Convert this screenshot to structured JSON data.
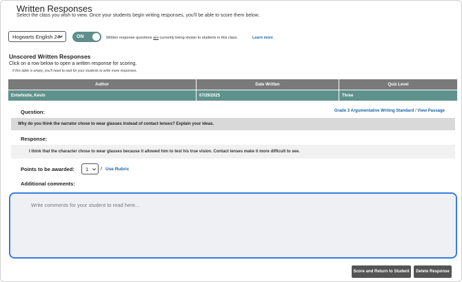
{
  "header": {
    "title": "Written Responses",
    "subtitle": "Select the class you wish to view. Once your students begin writing responses, you'll be able to score them below."
  },
  "class_selector": {
    "selected": "Hogwarts English 24"
  },
  "toggle": {
    "label": "ON",
    "state": "on",
    "color": "#5e8e8a"
  },
  "toggle_note": {
    "before": "Written response questions ",
    "emphasis": "are",
    "after": " currently being shown to students in this class.",
    "learn_more": "Learn more"
  },
  "unscored": {
    "title": "Unscored Written Responses",
    "instruction": "Click on a row below to open a written response for scoring.",
    "note": "If this table is empty, you'll need to wait for your students to write more responses."
  },
  "table": {
    "columns": [
      "Author",
      "Date Written",
      "Quiz Level"
    ],
    "rows": [
      {
        "author": "Entwhistle, Kevin",
        "date": "07/29/2025",
        "level": "Three"
      }
    ],
    "header_color": "#7a7a7a",
    "row_color": "#5f928d"
  },
  "question": {
    "label": "Question:",
    "standard_link": "Grade 3 Argumentative Writing Standard",
    "separator": "/",
    "passage_link": "View Passage",
    "text": "Why do you think the narrator chose to wear glasses instead of contact lenses? Explain your ideas."
  },
  "response": {
    "label": "Response:",
    "text": "I think that the character chose to wear glasses because it allowed him to test his true vision. Contact lenses make it more difficult to see."
  },
  "points": {
    "label": "Points to be awarded:",
    "value": "1",
    "slash": "/",
    "rubric_link": "Use Rubric"
  },
  "comments": {
    "label": "Additional comments:",
    "placeholder": "Write comments for your student to read here...",
    "value": ""
  },
  "buttons": {
    "score": "Score and Return to Student",
    "delete": "Delete Response"
  },
  "colors": {
    "accent_link": "#1a63a8",
    "focus_border": "#3a7be0",
    "button_bg": "#545454"
  },
  "icons": {
    "class_dropdown": "chevron-down-icon",
    "points_dropdown": "chevron-down-icon"
  }
}
